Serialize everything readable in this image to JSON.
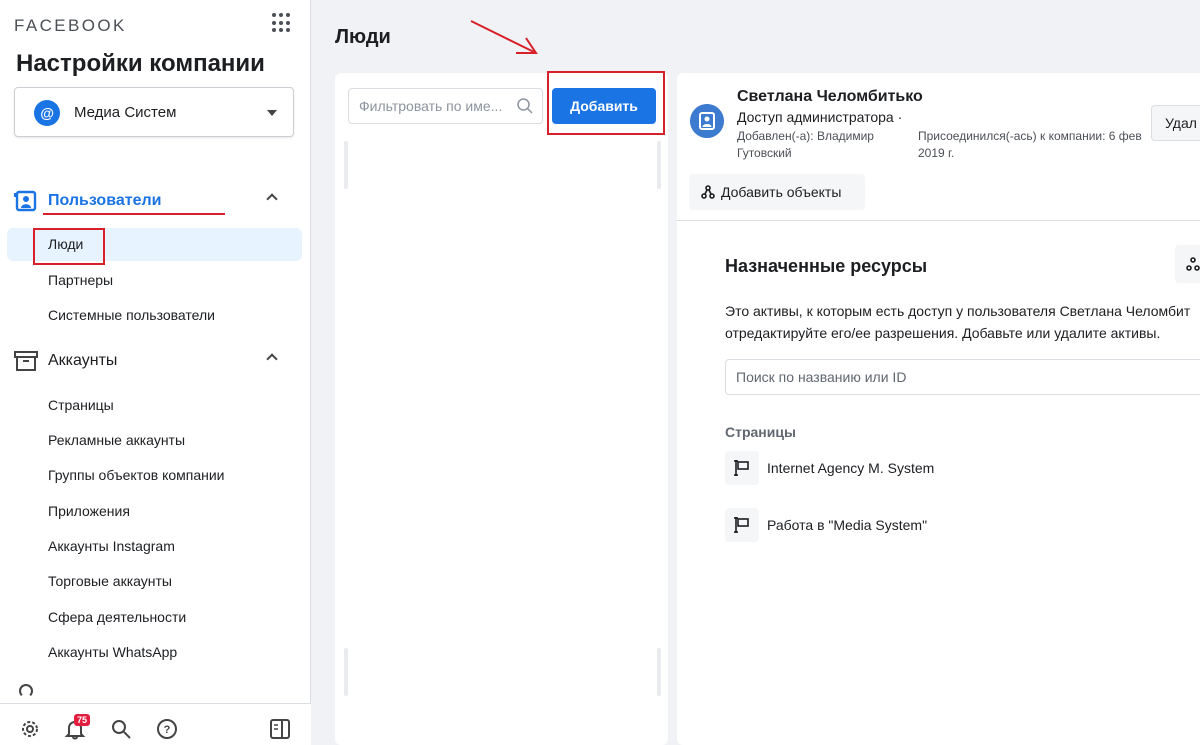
{
  "sidebar": {
    "brand": "FACEBOOK",
    "title": "Настройки компании",
    "business": {
      "name": "Медиа Систем",
      "logo_letter": "@"
    },
    "sections": [
      {
        "label": "Пользователи",
        "icon": "user-badge-icon",
        "expanded": true,
        "items": [
          {
            "label": "Люди",
            "active": true
          },
          {
            "label": "Партнеры"
          },
          {
            "label": "Системные пользователи"
          }
        ]
      },
      {
        "label": "Аккаунты",
        "icon": "archive-box-icon",
        "expanded": true,
        "items": [
          {
            "label": "Страницы"
          },
          {
            "label": "Рекламные аккаунты"
          },
          {
            "label": "Группы объектов компании"
          },
          {
            "label": "Приложения"
          },
          {
            "label": "Аккаунты Instagram"
          },
          {
            "label": "Торговые аккаунты"
          },
          {
            "label": "Сфера деятельности"
          },
          {
            "label": "Аккаунты WhatsApp"
          }
        ]
      }
    ],
    "bottom": {
      "notification_count": "75"
    }
  },
  "main": {
    "page_title": "Люди",
    "filter_placeholder": "Фильтровать по име...",
    "add_button": "Добавить"
  },
  "detail": {
    "user_name": "Светлана Челомбитько",
    "access": "Доступ администратора ·",
    "added_by": "Добавлен(-а): Владимир Гутовский",
    "joined": "Присоединился(-ась) к компании: 6 фев 2019 г.",
    "remove_button": "Удал",
    "add_objects_button": "Добавить объекты",
    "assigned_title": "Назначенные ресурсы",
    "assigned_desc_1": "Это активы, к которым есть доступ у пользователя Светлана Челомбит",
    "assigned_desc_2": "отредактируйте его/ее разрешения. Добавьте или удалите активы.",
    "search_placeholder": "Поиск по названию или ID",
    "pages_label": "Страницы",
    "pages": [
      {
        "name": "Internet Agency M. System"
      },
      {
        "name": "Работа в \"Media System\""
      }
    ]
  },
  "colors": {
    "accent": "#1b74e4",
    "annotation_red": "#d8202b",
    "active_bg": "#e7f3ff",
    "badge": "#e41e3f"
  }
}
